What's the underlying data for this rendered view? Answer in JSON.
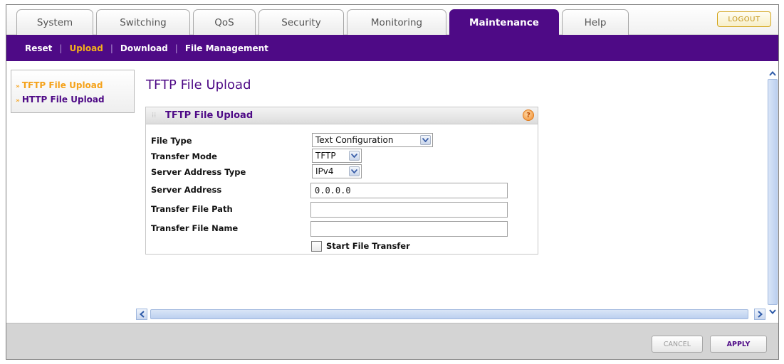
{
  "tabs": [
    {
      "label": "System"
    },
    {
      "label": "Switching"
    },
    {
      "label": "QoS"
    },
    {
      "label": "Security"
    },
    {
      "label": "Monitoring"
    },
    {
      "label": "Maintenance",
      "active": true
    },
    {
      "label": "Help"
    }
  ],
  "logout_label": "LOGOUT",
  "subnav": {
    "items": [
      {
        "label": "Reset"
      },
      {
        "label": "Upload",
        "active": true
      },
      {
        "label": "Download"
      },
      {
        "label": "File Management"
      }
    ],
    "separator": "|"
  },
  "leftnav": {
    "items": [
      {
        "label": "TFTP File Upload",
        "active": true
      },
      {
        "label": "HTTP File Upload"
      }
    ]
  },
  "page_title": "TFTP File Upload",
  "panel": {
    "title": "TFTP File Upload",
    "help_icon": "?",
    "fields": {
      "file_type": {
        "label": "File Type",
        "value": "Text Configuration"
      },
      "transfer_mode": {
        "label": "Transfer Mode",
        "value": "TFTP"
      },
      "server_address_type": {
        "label": "Server Address Type",
        "value": "IPv4"
      },
      "server_address": {
        "label": "Server Address",
        "value": "0.0.0.0"
      },
      "transfer_file_path": {
        "label": "Transfer File Path",
        "value": ""
      },
      "transfer_file_name": {
        "label": "Transfer File Name",
        "value": ""
      }
    },
    "start_transfer_label": "Start File Transfer",
    "start_transfer_checked": false
  },
  "footer": {
    "cancel_label": "CANCEL",
    "apply_label": "APPLY"
  },
  "colors": {
    "brand_purple": "#4e0a86",
    "accent_orange": "#f5b21a",
    "footer_gray": "#d4d4d4"
  },
  "icons": {
    "select_caret": "chevron-down-icon",
    "help": "help-icon",
    "scroll_up": "chevron-up-icon",
    "scroll_down": "chevron-down-icon",
    "scroll_left": "chevron-left-icon",
    "scroll_right": "chevron-right-icon"
  }
}
